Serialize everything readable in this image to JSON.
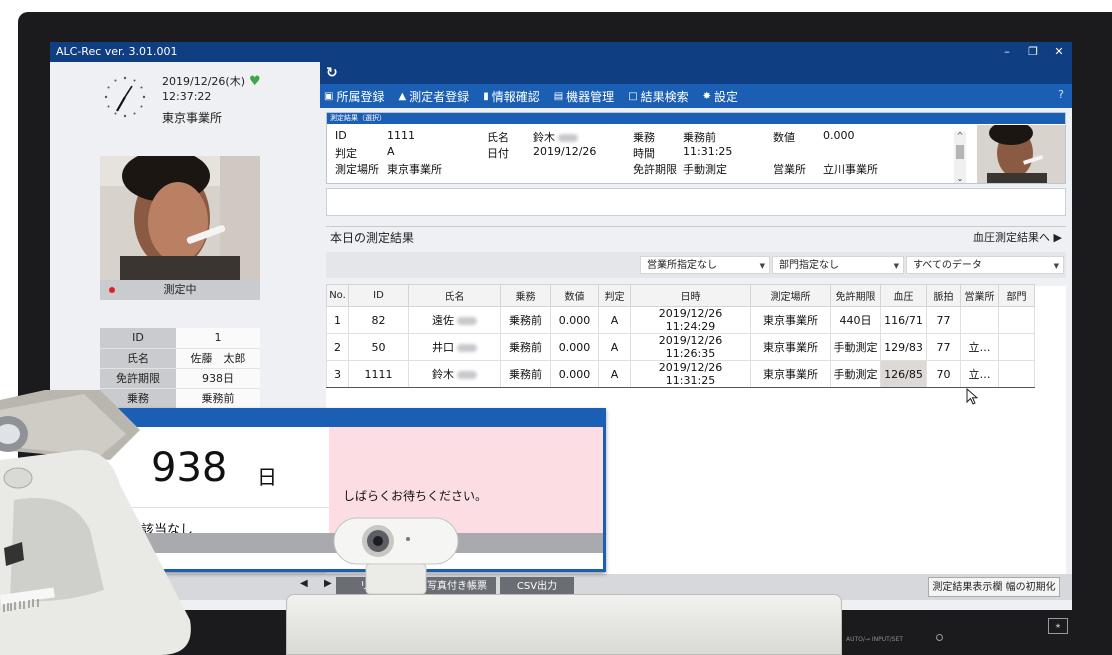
{
  "window": {
    "title": "ALC-Rec  ver. 3.01.001",
    "controls": [
      "–",
      "❐",
      "✕"
    ]
  },
  "left": {
    "date": "2019/12/26(木)",
    "time": "12:37:22",
    "office": "東京事業所",
    "status": "測定中",
    "info": [
      {
        "key": "ID",
        "value": "1"
      },
      {
        "key": "氏名",
        "value": "佐藤　太郎"
      },
      {
        "key": "免許期限",
        "value": "938日"
      },
      {
        "key": "乗務",
        "value": "乗務前"
      }
    ]
  },
  "menu": [
    {
      "icon": "building-icon",
      "glyph": "▣",
      "label": "所属登録"
    },
    {
      "icon": "person-icon",
      "glyph": "▲",
      "label": "測定者登録"
    },
    {
      "icon": "card-icon",
      "glyph": "▮",
      "label": "情報確認"
    },
    {
      "icon": "monitor-icon",
      "glyph": "▤",
      "label": "機器管理"
    },
    {
      "icon": "calendar-icon",
      "glyph": "□",
      "label": "結果検索"
    },
    {
      "icon": "gear-icon",
      "glyph": "✸",
      "label": "設定"
    }
  ],
  "help": "?",
  "refresh": "↻",
  "selected": {
    "header": "測定結果（選択）",
    "id_label": "ID",
    "id": "1111",
    "name_label": "氏名",
    "name": "鈴木",
    "duty_label": "乗務",
    "duty": "乗務前",
    "value_label": "数値",
    "value": "0.000",
    "judge_label": "判定",
    "judge": "A",
    "date_label": "日付",
    "date": "2019/12/26",
    "time_label": "時間",
    "time": "11:31:25",
    "place_label": "測定場所",
    "place": "東京事業所",
    "license_label": "免許期限",
    "license": "手動測定",
    "branch_label": "営業所",
    "branch": "立川事業所"
  },
  "today": {
    "title": "本日の測定結果",
    "bp_link": "血圧測定結果へ ▶"
  },
  "filters": {
    "branch": "営業所指定なし",
    "dept": "部門指定なし",
    "data": "すべてのデータ"
  },
  "table": {
    "headers": [
      "No.",
      "ID",
      "氏名",
      "乗務",
      "数値",
      "判定",
      "日時",
      "測定場所",
      "免許期限",
      "血圧",
      "脈拍",
      "営業所",
      "部門"
    ],
    "rows": [
      [
        "1",
        "82",
        "遠佐",
        "乗務前",
        "0.000",
        "A",
        "2019/12/26 11:24:29",
        "東京事業所",
        "440日",
        "116/71",
        "77",
        "",
        ""
      ],
      [
        "2",
        "50",
        "井口",
        "乗務前",
        "0.000",
        "A",
        "2019/12/26 11:26:35",
        "東京事業所",
        "手動測定",
        "129/83",
        "77",
        "立…",
        ""
      ],
      [
        "3",
        "1111",
        "鈴木",
        "乗務前",
        "0.000",
        "A",
        "2019/12/26 11:31:25",
        "東京事業所",
        "手動測定",
        "126/85",
        "70",
        "立…",
        ""
      ]
    ]
  },
  "bottom": {
    "list": "リスト",
    "photo_report": "写真付き帳票",
    "csv": "CSV出力",
    "reset": "測定結果表示欄 幅の初期化"
  },
  "monitor": {
    "title": "証モニター",
    "days": "938",
    "unit": "日",
    "none": "該当なし",
    "wait": "しばらくお待ちください。"
  },
  "bezel": {
    "label": "AUTO/→ INPUT/SET"
  }
}
